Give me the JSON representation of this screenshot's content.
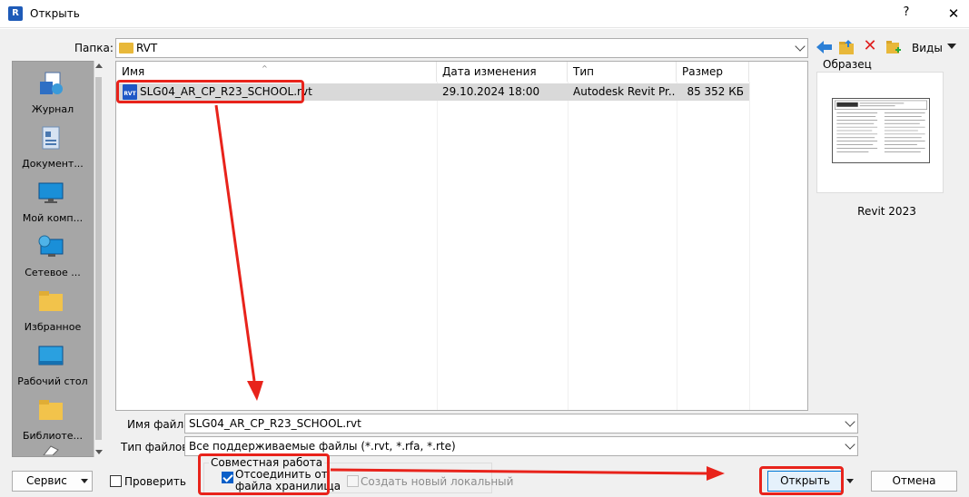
{
  "window": {
    "title": "Открыть",
    "help_label": "?",
    "close_label": "✕"
  },
  "folder": {
    "label": "Папка:",
    "value": "RVT"
  },
  "toolbar": {
    "views_label": "Виды"
  },
  "places": [
    {
      "label": "Журнал",
      "icon": "history-icon"
    },
    {
      "label": "Документ...",
      "icon": "documents-icon"
    },
    {
      "label": "Мой комп...",
      "icon": "computer-icon"
    },
    {
      "label": "Сетевое ...",
      "icon": "network-icon"
    },
    {
      "label": "Избранное",
      "icon": "favorites-folder-icon"
    },
    {
      "label": "Рабочий стол",
      "icon": "desktop-icon"
    },
    {
      "label": "Библиоте...",
      "icon": "library-folder-icon"
    }
  ],
  "file_list": {
    "columns": [
      "Имя",
      "Дата изменения",
      "Тип",
      "Размер"
    ],
    "rows": [
      {
        "name": "SLG04_AR_CP_R23_SCHOOL.rvt",
        "date": "29.10.2024 18:00",
        "type": "Autodesk Revit Pr...",
        "size": "85 352 КБ"
      }
    ]
  },
  "preview": {
    "label": "Образец",
    "caption": "Revit 2023"
  },
  "file_name": {
    "label": "Имя файла:",
    "value": "SLG04_AR_CP_R23_SCHOOL.rvt"
  },
  "file_type": {
    "label": "Тип файлов:",
    "value": "Все поддерживаемые файлы (*.rvt, *.rfa, *.rte)"
  },
  "bottom": {
    "service_label": "Сервис",
    "audit_label": "Проверить",
    "audit_checked": false,
    "collab_group_label": "Совместная работа",
    "detach_label_line1": "Отсоединить от",
    "detach_label_line2": "файла хранилища",
    "detach_checked": true,
    "new_local_label": "Создать новый локальный",
    "new_local_enabled": false,
    "open_label": "Открыть",
    "cancel_label": "Отмена"
  },
  "colors": {
    "annotation_red": "#e8231b",
    "selection_gray": "#d9d9d9",
    "checkbox_blue": "#0a5fc8"
  }
}
